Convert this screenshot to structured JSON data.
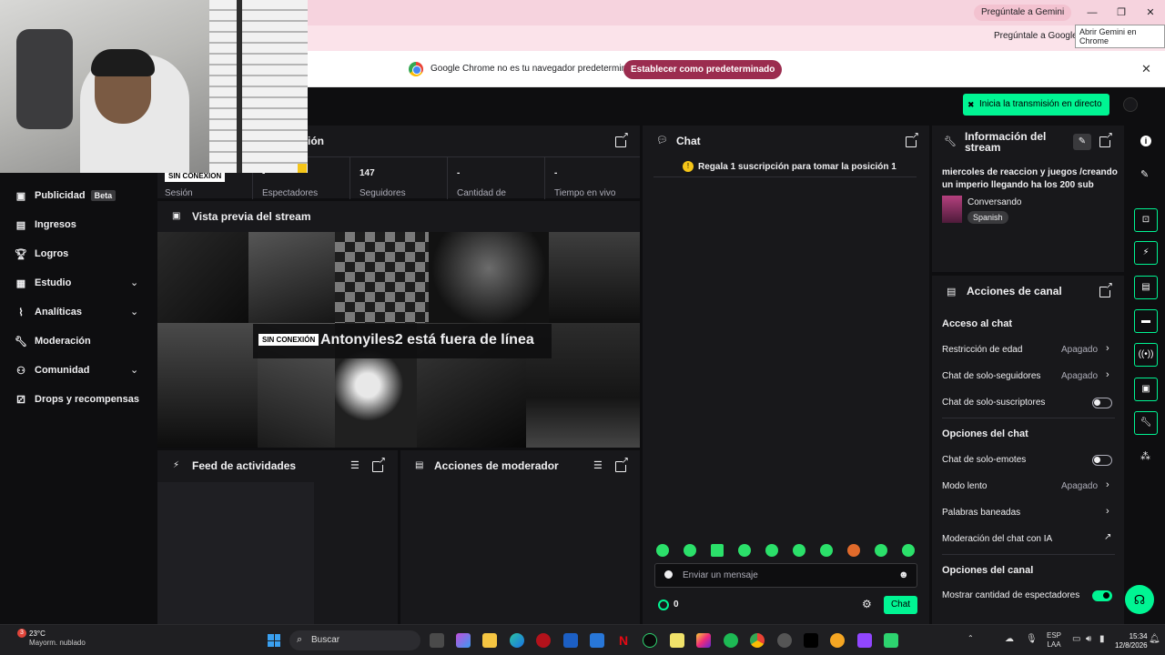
{
  "browser": {
    "gemini_pill": "Pregúntale a Gemini",
    "tooltip": "Abrir Gemini en Chrome",
    "gemini_toolbar": "Pregúntale a Google",
    "window_controls": [
      "—",
      "❐",
      "✕"
    ],
    "infobar_message": "Google Chrome no es tu navegador predeterminado",
    "infobar_button": "Establecer como predeterminado"
  },
  "header": {
    "go_live": "Inicia la transmisión en directo"
  },
  "sidebar": {
    "items": [
      {
        "label": "Publicidad",
        "badge": "Beta",
        "icon": "megaphone-icon"
      },
      {
        "label": "Ingresos",
        "icon": "revenue-icon"
      },
      {
        "label": "Logros",
        "icon": "trophy-icon"
      },
      {
        "label": "Estudio",
        "icon": "studio-icon",
        "expandable": true
      },
      {
        "label": "Analíticas",
        "icon": "analytics-icon",
        "expandable": true
      },
      {
        "label": "Moderación",
        "icon": "wrench-icon"
      },
      {
        "label": "Comunidad",
        "icon": "community-icon",
        "expandable": true
      },
      {
        "label": "Drops y recompensas",
        "icon": "drops-icon"
      }
    ]
  },
  "session_panel": {
    "title_partial": "ión",
    "offline_tag": "SIN CONEXIÓN",
    "stats": [
      {
        "value": "",
        "label": "Sesión"
      },
      {
        "value": "-",
        "label": "Espectadores"
      },
      {
        "value": "147",
        "label": "Seguidores"
      },
      {
        "value": "-",
        "label": "Cantidad de"
      },
      {
        "value": "-",
        "label": "Tiempo en vivo"
      }
    ]
  },
  "preview": {
    "title": "Vista previa del stream",
    "offline_tag": "SIN CONEXIÓN",
    "offline_message": "Antonyiles2 está fuera de línea"
  },
  "activity_feed": {
    "title": "Feed de actividades"
  },
  "mod_actions": {
    "title": "Acciones de moderador"
  },
  "chat": {
    "title": "Chat",
    "banner": "Regala 1 suscripción para tomar la posición 1",
    "placeholder": "Enviar un mensaje",
    "points": "0",
    "send_label": "Chat"
  },
  "stream_info": {
    "title_line1": "Información del",
    "title_line2": "stream",
    "stream_title_line1": "miercoles de reaccion y juegos /creando",
    "stream_title_line2": "un imperio llegando ha los 200 sub",
    "category": "Conversando",
    "language": "Spanish"
  },
  "channel_actions": {
    "title": "Acciones de canal",
    "chat_access_header": "Acceso al chat",
    "age_restriction": {
      "label": "Restricción de edad",
      "value": "Apagado"
    },
    "followers_only": {
      "label": "Chat de solo-seguidores",
      "value": "Apagado"
    },
    "subs_only": {
      "label": "Chat de solo-suscriptores",
      "on": false
    },
    "chat_options_header": "Opciones del chat",
    "emotes_only": {
      "label": "Chat de solo-emotes",
      "on": false
    },
    "slow_mode": {
      "label": "Modo lento",
      "value": "Apagado"
    },
    "banned_words": {
      "label": "Palabras baneadas"
    },
    "ai_moderation": {
      "label": "Moderación del chat con IA"
    },
    "channel_options_header": "Opciones del canal",
    "show_viewer_count": {
      "label": "Mostrar cantidad de espectadores",
      "on": true
    }
  },
  "taskbar": {
    "notif_count": "3",
    "temperature": "23°C",
    "condition": "Mayorm. nublado",
    "search": "Buscar",
    "lang_line1": "ESP",
    "lang_line2": "LAA",
    "time": "15:34",
    "date": "12/8/2026"
  },
  "colors": {
    "accent": "#00f593",
    "panel": "#18181b",
    "background": "#0e0e10",
    "infobar_button": "#9b2c4f"
  }
}
